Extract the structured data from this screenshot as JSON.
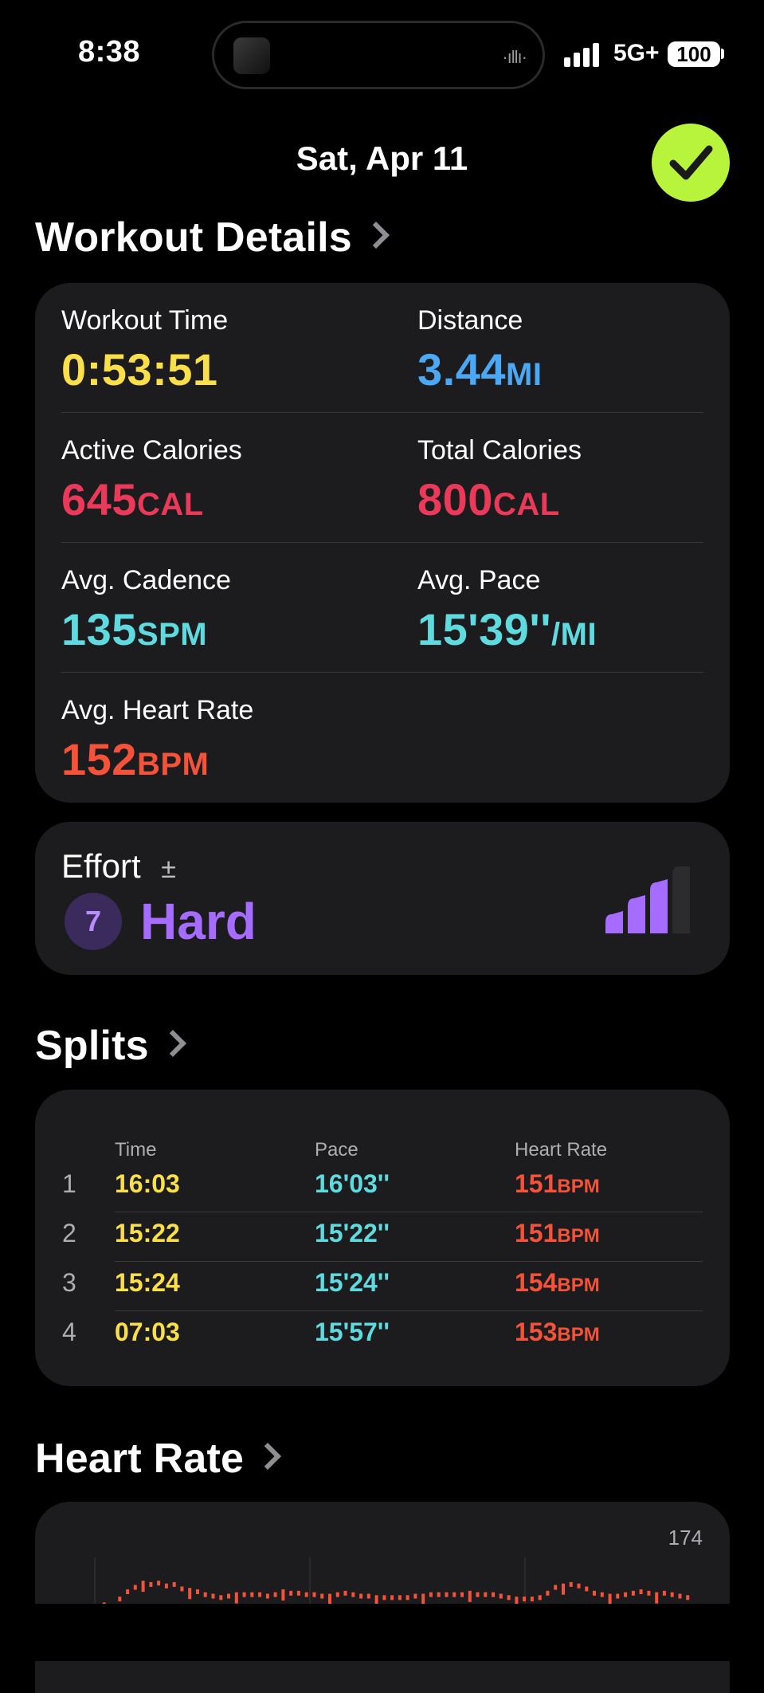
{
  "status_bar": {
    "time": "8:38",
    "network": "5G+",
    "battery": "100"
  },
  "header": {
    "date": "Sat, Apr 11"
  },
  "workout_details": {
    "title": "Workout Details",
    "metrics": {
      "workout_time": {
        "label": "Workout Time",
        "value": "0:53:51",
        "unit": ""
      },
      "distance": {
        "label": "Distance",
        "value": "3.44",
        "unit": "MI"
      },
      "active_calories": {
        "label": "Active Calories",
        "value": "645",
        "unit": "CAL"
      },
      "total_calories": {
        "label": "Total Calories",
        "value": "800",
        "unit": "CAL"
      },
      "avg_cadence": {
        "label": "Avg. Cadence",
        "value": "135",
        "unit": "SPM"
      },
      "avg_pace": {
        "label": "Avg. Pace",
        "value": "15'39''",
        "unit": "/MI"
      },
      "avg_heart_rate": {
        "label": "Avg. Heart Rate",
        "value": "152",
        "unit": "BPM"
      }
    }
  },
  "effort": {
    "label": "Effort",
    "adjust_symbol": "±",
    "score": "7",
    "text": "Hard",
    "level": 3,
    "max_level": 4
  },
  "splits": {
    "title": "Splits",
    "headers": {
      "time": "Time",
      "pace": "Pace",
      "heart_rate": "Heart Rate"
    },
    "rows": [
      {
        "index": "1",
        "time": "16:03",
        "pace": "16'03''",
        "hr": "151",
        "hr_unit": "BPM"
      },
      {
        "index": "2",
        "time": "15:22",
        "pace": "15'22''",
        "hr": "151",
        "hr_unit": "BPM"
      },
      {
        "index": "3",
        "time": "15:24",
        "pace": "15'24''",
        "hr": "154",
        "hr_unit": "BPM"
      },
      {
        "index": "4",
        "time": "07:03",
        "pace": "15'57''",
        "hr": "153",
        "hr_unit": "BPM"
      }
    ]
  },
  "heart_rate": {
    "title": "Heart Rate",
    "max_label": "174",
    "chart_data": {
      "type": "bar",
      "values": [
        140,
        143,
        141,
        147,
        152,
        155,
        158,
        157,
        158,
        156,
        157,
        154,
        153,
        152,
        150,
        149,
        148,
        149,
        150,
        150,
        150,
        150,
        149,
        150,
        152,
        151,
        151,
        150,
        150,
        149,
        149,
        150,
        151,
        150,
        149,
        149,
        148,
        148,
        148,
        148,
        148,
        149,
        149,
        150,
        150,
        150,
        150,
        150,
        151,
        150,
        150,
        150,
        149,
        148,
        147,
        147,
        147,
        148,
        151,
        155,
        156,
        157,
        156,
        154,
        151,
        150,
        149,
        149,
        150,
        151,
        152,
        151,
        150,
        151,
        150,
        149,
        148
      ]
    }
  }
}
